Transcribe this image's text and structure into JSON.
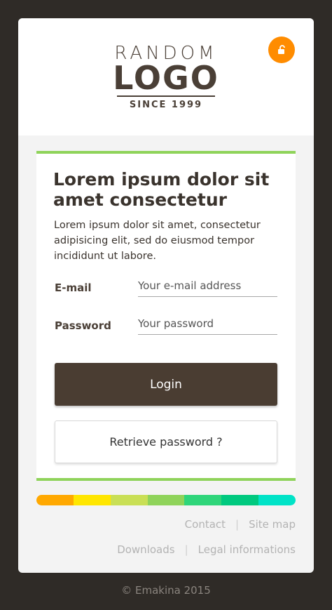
{
  "logo": {
    "line1": "RANDOM",
    "line2": "LOGO",
    "tagline": "SINCE 1999"
  },
  "icons": {
    "lock": "unlock-icon"
  },
  "intro": {
    "title": "Lorem ipsum dolor sit amet consectetur",
    "text": "Lorem ipsum dolor sit amet, consectetur adipisicing elit, sed do eiusmod tempor incididunt ut labore."
  },
  "form": {
    "email_label": "E-mail",
    "email_placeholder": "Your e-mail address",
    "email_value": "",
    "password_label": "Password",
    "password_placeholder": "Your password",
    "password_value": "",
    "login_label": "Login",
    "retrieve_label": "Retrieve password ?"
  },
  "color_bar": [
    "#ffa800",
    "#ffe600",
    "#c9df55",
    "#8fd35a",
    "#2fd57a",
    "#00c97f",
    "#00e3c7"
  ],
  "footer_links": {
    "row1": [
      "Contact",
      "Site map"
    ],
    "row2": [
      "Downloads",
      "Legal informations"
    ],
    "separator": "|"
  },
  "copyright": "© Emakina 2015",
  "colors": {
    "accent_green": "#8fd35a",
    "accent_orange": "#ff8c00",
    "brand_brown": "#4a3d32"
  }
}
